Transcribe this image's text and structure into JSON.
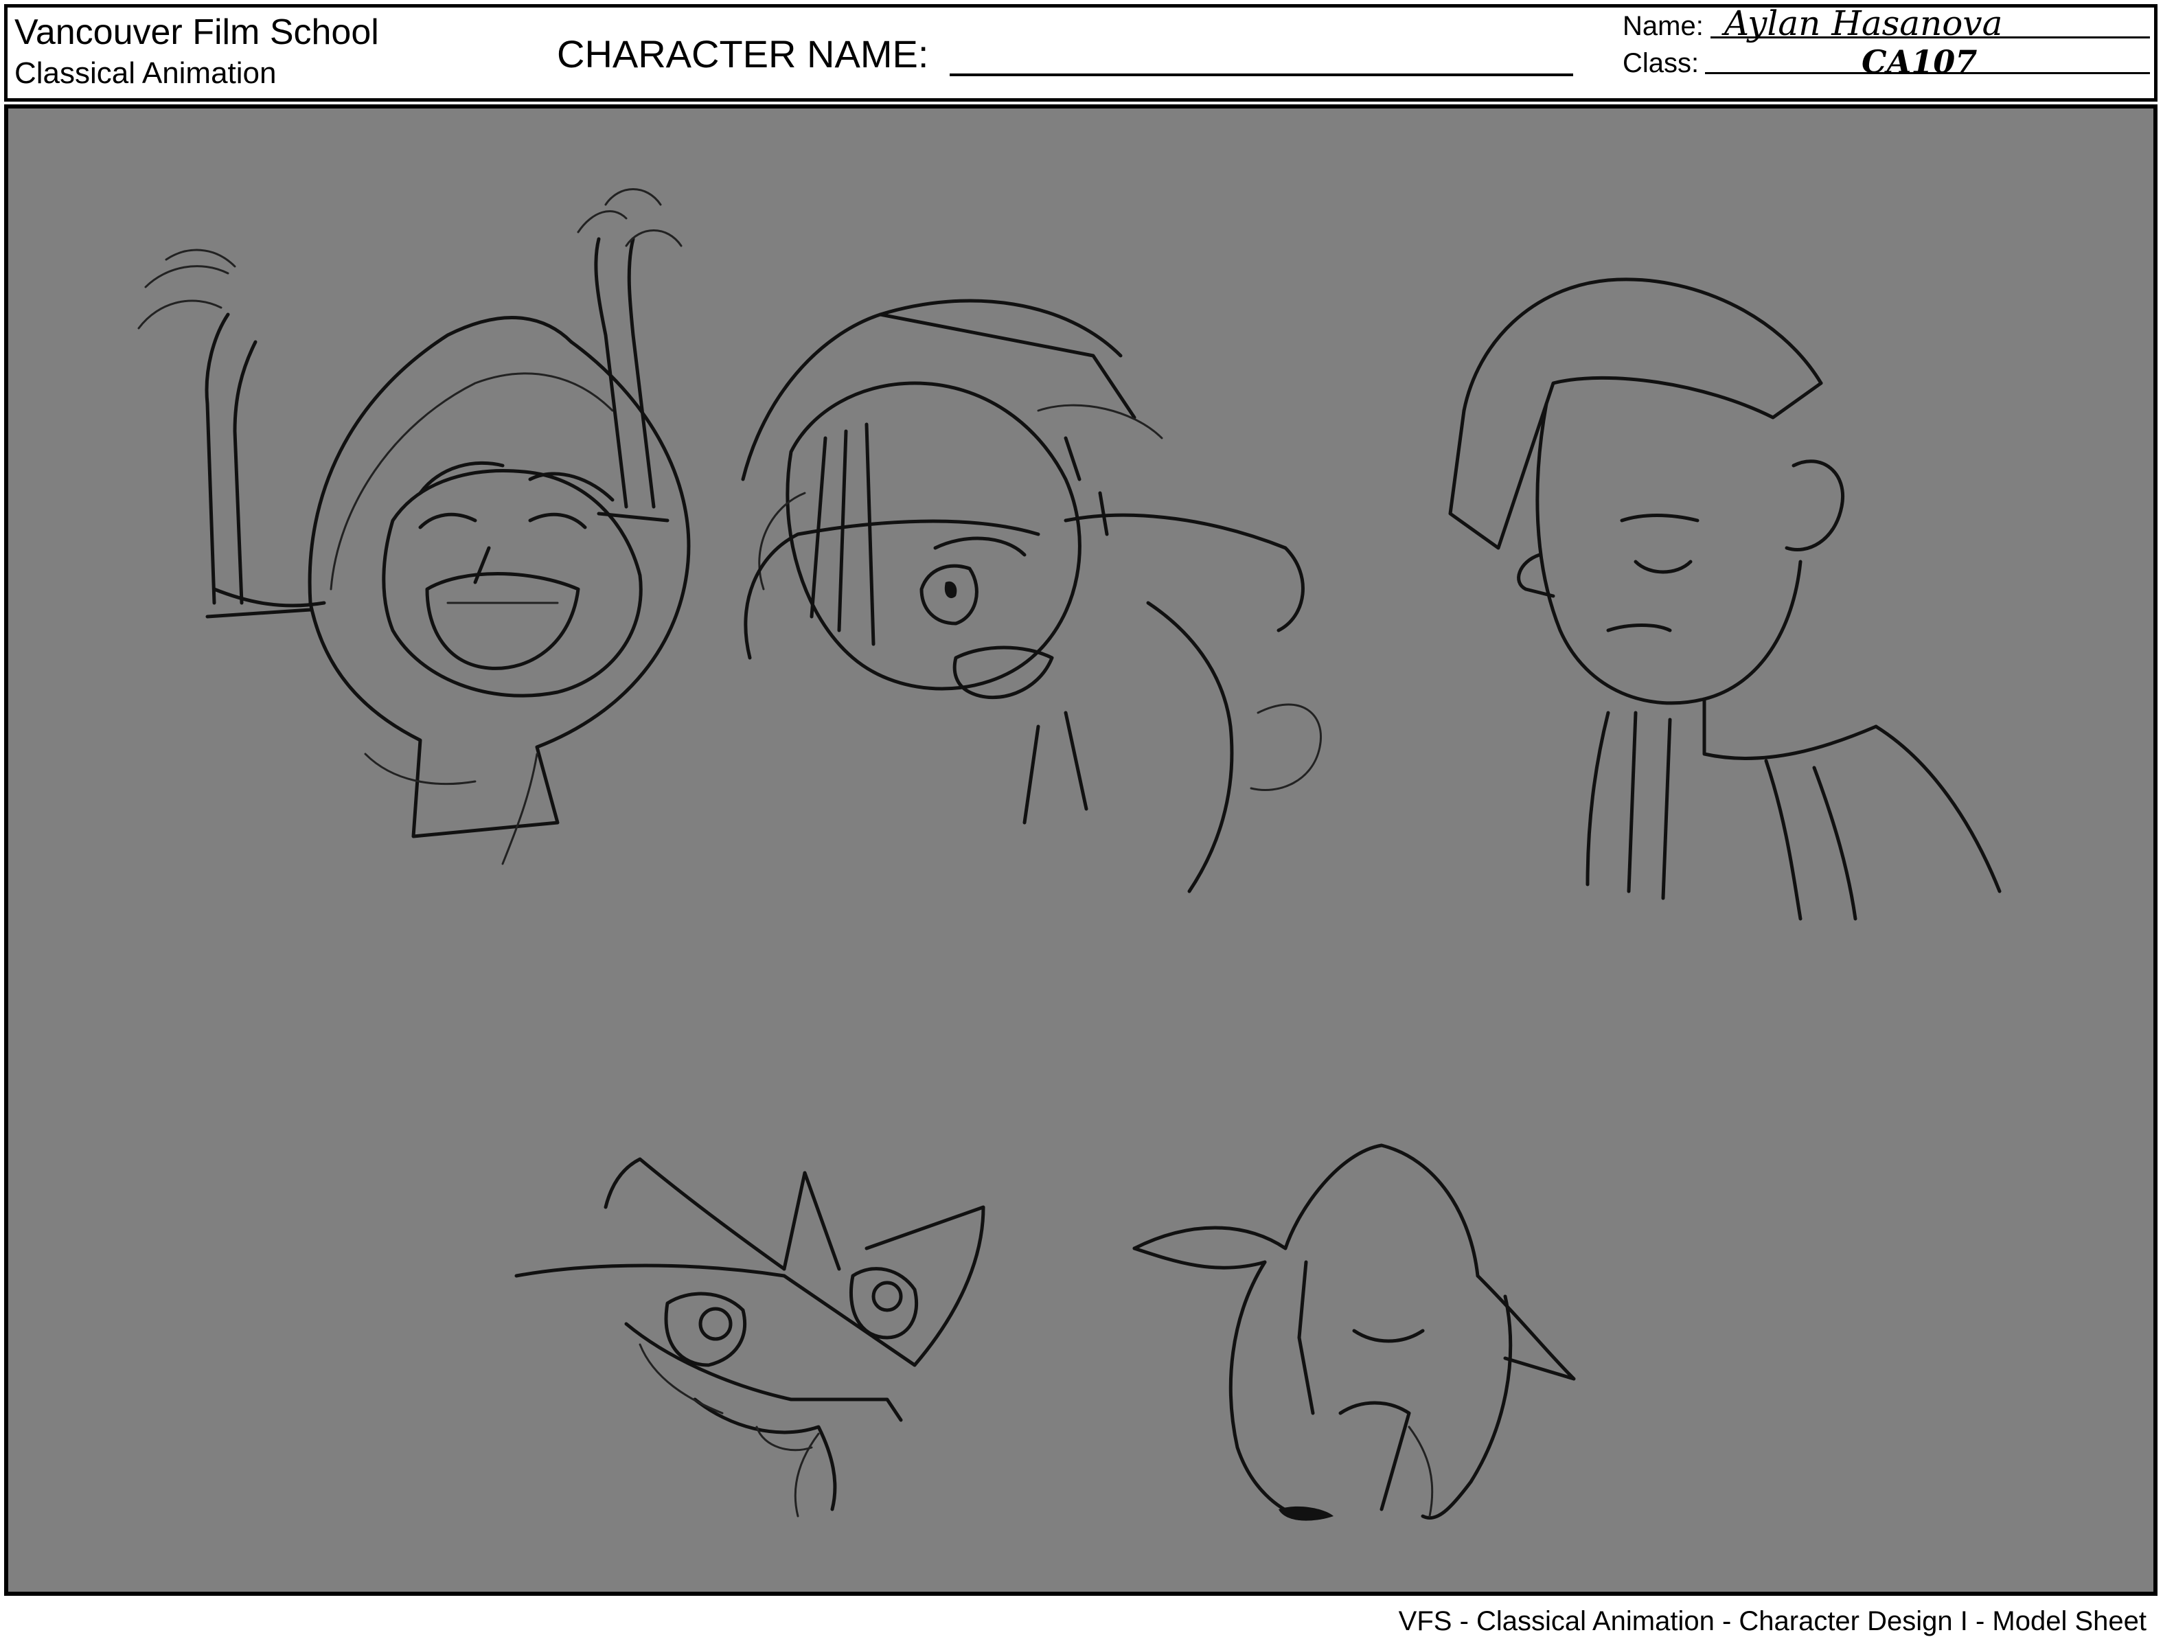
{
  "header": {
    "school": "Vancouver Film School",
    "department": "Classical Animation",
    "character_label": "CHARACTER NAME:",
    "name_label": "Name:",
    "name_value": "Aylan Hasanova",
    "class_label": "Class:",
    "class_value": "CA107"
  },
  "footer": {
    "text": "VFS - Classical Animation - Character Design I - Model Sheet"
  },
  "sketches": [
    {
      "icon": "laughing-hooded-character-sketch"
    },
    {
      "icon": "angry-hooded-character-sketch"
    },
    {
      "icon": "sad-boy-character-sketch"
    },
    {
      "icon": "surprised-fox-head-sketch"
    },
    {
      "icon": "sad-fox-head-sketch"
    }
  ],
  "colors": {
    "panel_background": "#808080",
    "ink": "#111111",
    "border": "#000000"
  }
}
